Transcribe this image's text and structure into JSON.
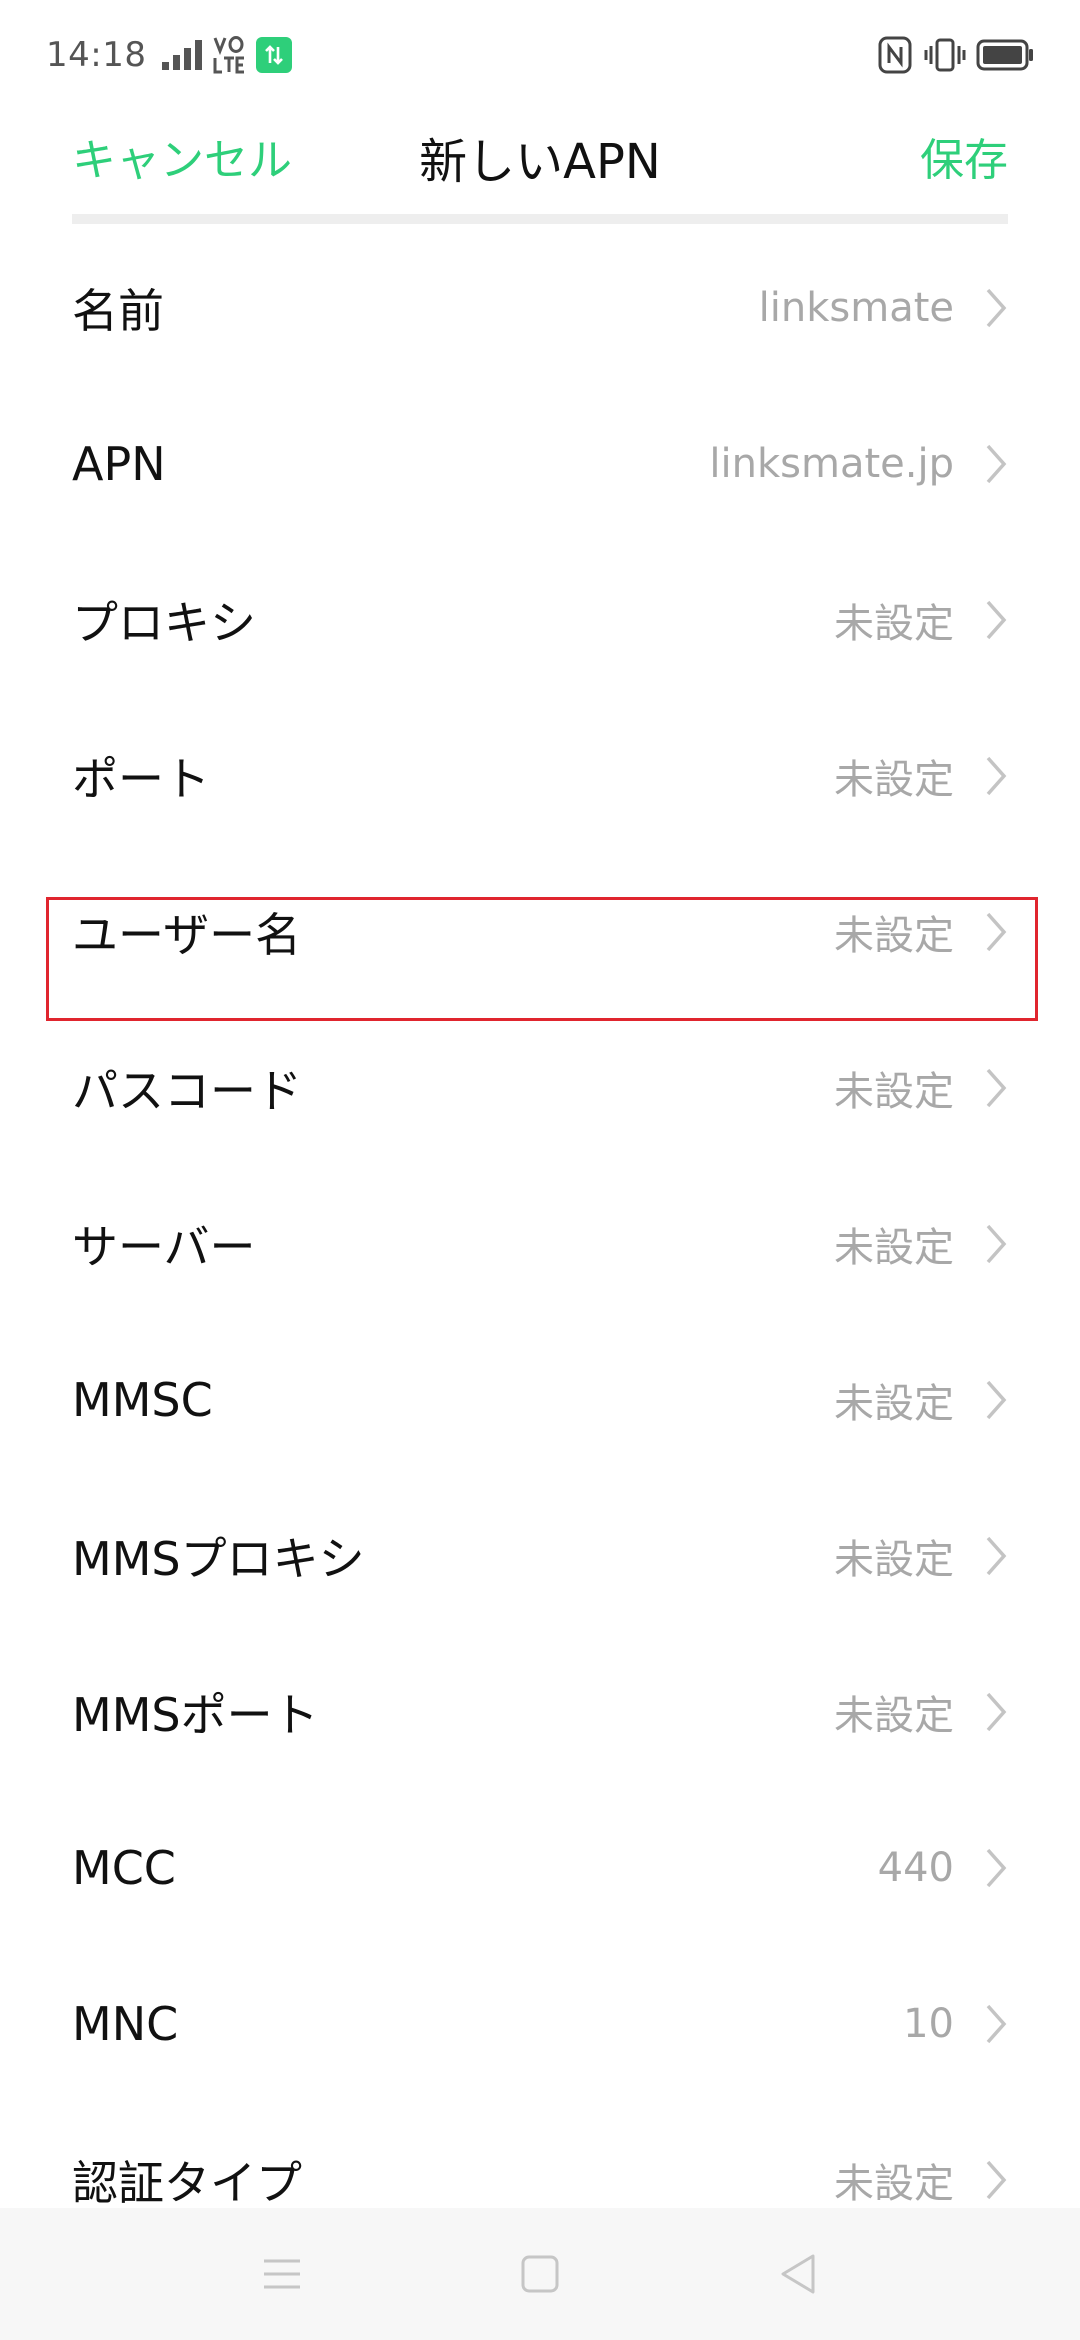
{
  "status_bar": {
    "time": "14:18",
    "icons": [
      "signal-icon",
      "volte-icon",
      "data-transfer-icon",
      "nfc-icon",
      "vibrate-icon",
      "battery-icon"
    ]
  },
  "header": {
    "cancel_label": "キャンセル",
    "title": "新しいAPN",
    "save_label": "保存",
    "accent_color": "#2ecf7a"
  },
  "settings": [
    {
      "label": "名前",
      "value": "linksmate"
    },
    {
      "label": "APN",
      "value": "linksmate.jp"
    },
    {
      "label": "プロキシ",
      "value": "未設定"
    },
    {
      "label": "ポート",
      "value": "未設定"
    },
    {
      "label": "ユーザー名",
      "value": "未設定"
    },
    {
      "label": "パスコード",
      "value": "未設定"
    },
    {
      "label": "サーバー",
      "value": "未設定"
    },
    {
      "label": "MMSC",
      "value": "未設定"
    },
    {
      "label": "MMSプロキシ",
      "value": "未設定"
    },
    {
      "label": "MMSポート",
      "value": "未設定"
    },
    {
      "label": "MCC",
      "value": "440"
    },
    {
      "label": "MNC",
      "value": "10"
    },
    {
      "label": "認証タイプ",
      "value": "未設定"
    }
  ],
  "highlight": {
    "item": "ユーザー名",
    "color": "#e0252e"
  },
  "nav_bar": {
    "icons": [
      "menu-icon",
      "home-icon",
      "back-icon"
    ]
  }
}
